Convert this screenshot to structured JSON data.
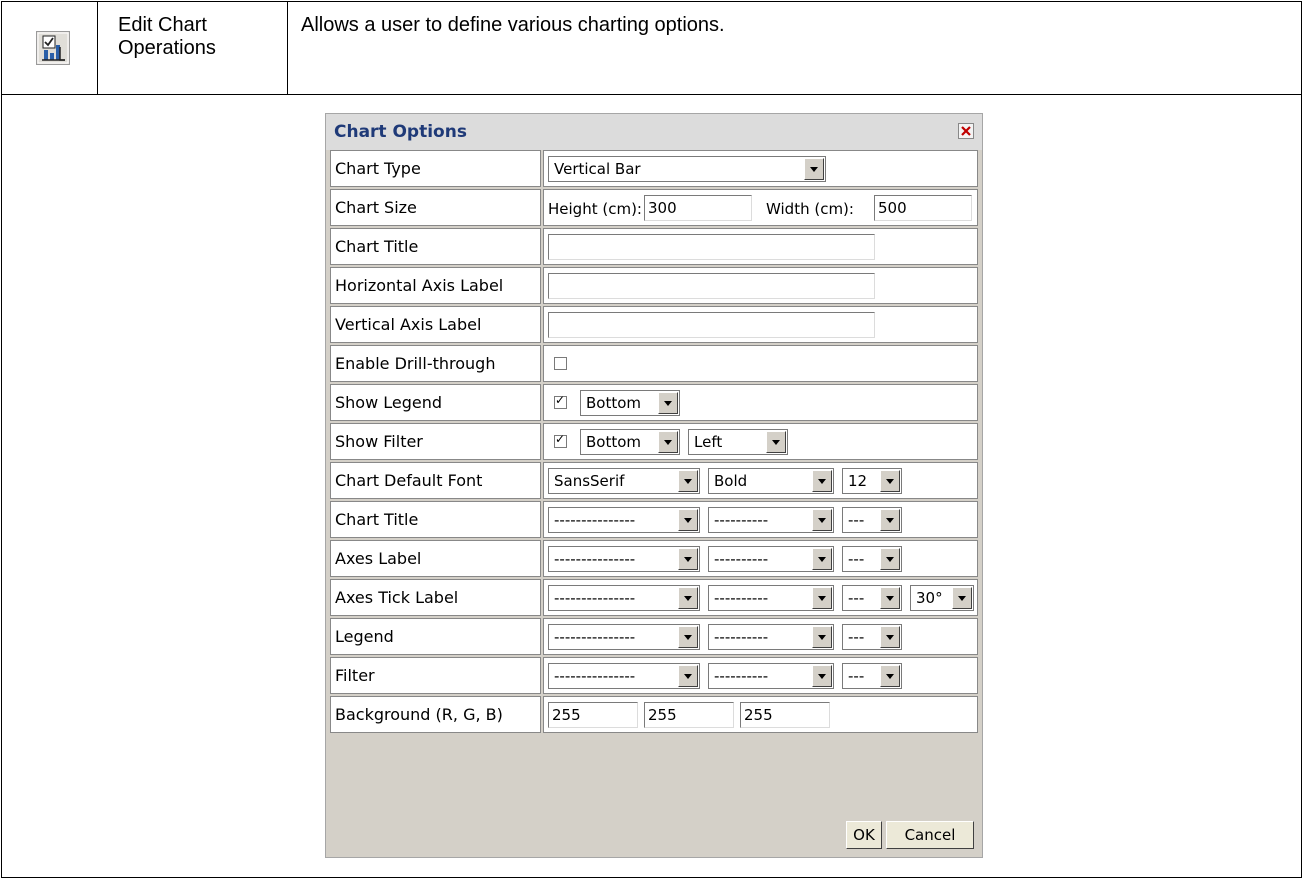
{
  "feature": {
    "name_line1": "Edit Chart",
    "name_line2": "Operations",
    "description": "Allows a user to define various charting options.",
    "icon": "chart-edit-icon"
  },
  "dialog": {
    "title": "Chart Options",
    "close_icon": "close-icon",
    "rows": {
      "chart_type": {
        "label": "Chart Type",
        "value": "Vertical Bar"
      },
      "chart_size": {
        "label": "Chart Size",
        "height_label": "Height (cm):",
        "height_value": "300",
        "width_label": "Width (cm):",
        "width_value": "500"
      },
      "chart_title": {
        "label": "Chart Title",
        "value": ""
      },
      "h_axis": {
        "label": "Horizontal Axis Label",
        "value": ""
      },
      "v_axis": {
        "label": "Vertical Axis Label",
        "value": ""
      },
      "drill": {
        "label": "Enable Drill-through",
        "checked": false
      },
      "legend": {
        "label": "Show Legend",
        "checked": true,
        "position": "Bottom"
      },
      "filter": {
        "label": "Show Filter",
        "checked": true,
        "position": "Bottom",
        "align": "Left"
      },
      "default_font": {
        "label": "Chart Default Font",
        "family": "SansSerif",
        "style": "Bold",
        "size": "12"
      },
      "title_font": {
        "label": "Chart Title",
        "family": "---------------",
        "style": "----------",
        "size": "---"
      },
      "axes_font": {
        "label": "Axes Label",
        "family": "---------------",
        "style": "----------",
        "size": "---"
      },
      "tick_font": {
        "label": "Axes Tick Label",
        "family": "---------------",
        "style": "----------",
        "size": "---",
        "angle": "30°"
      },
      "legend_font": {
        "label": "Legend",
        "family": "---------------",
        "style": "----------",
        "size": "---"
      },
      "filter_font": {
        "label": "Filter",
        "family": "---------------",
        "style": "----------",
        "size": "---"
      },
      "background": {
        "label": "Background (R, G, B)",
        "r": "255",
        "g": "255",
        "b": "255"
      }
    },
    "buttons": {
      "ok": "OK",
      "cancel": "Cancel"
    }
  }
}
